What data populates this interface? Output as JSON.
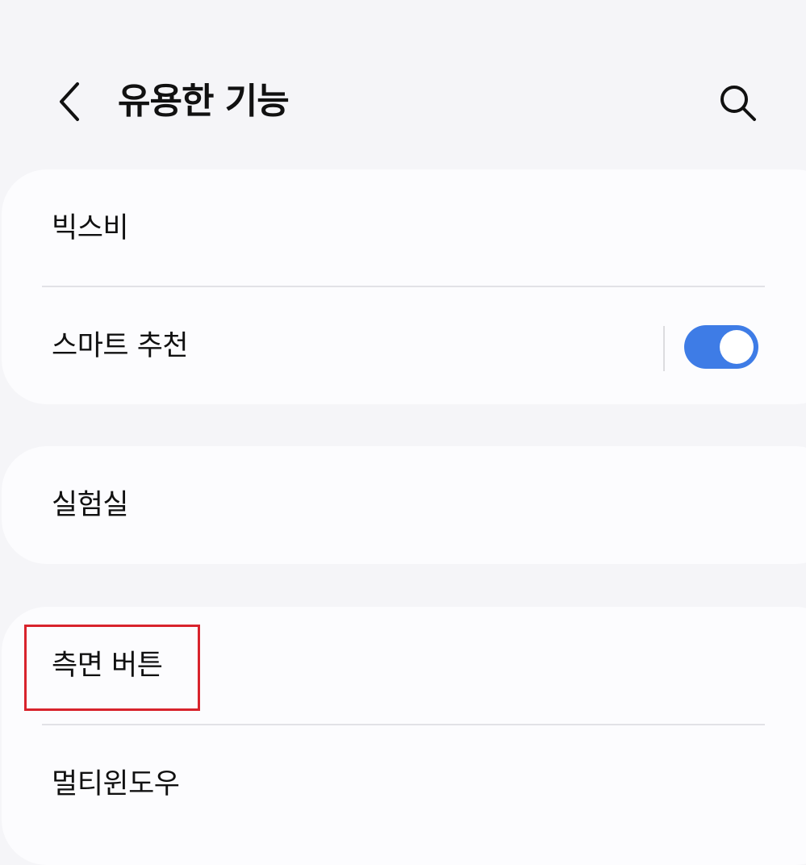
{
  "header": {
    "back_icon": "chevron-left-icon",
    "title": "유용한 기능",
    "search_icon": "search-icon"
  },
  "groups": [
    {
      "items": [
        {
          "label": "빅스비"
        },
        {
          "label": "스마트 추천",
          "toggle": {
            "state": "on",
            "color": "#3e7ce6"
          }
        }
      ]
    },
    {
      "items": [
        {
          "label": "실험실"
        }
      ]
    },
    {
      "items": [
        {
          "label": "측면 버튼",
          "highlighted": true
        },
        {
          "label": "멀티윈도우"
        }
      ]
    }
  ],
  "colors": {
    "background": "#f5f5f8",
    "card": "#fcfcfe",
    "accent": "#3e7ce6",
    "highlight_box": "#d8232c"
  }
}
